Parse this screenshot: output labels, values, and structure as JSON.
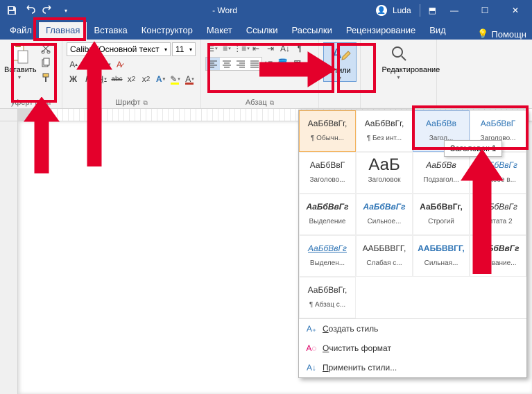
{
  "colors": {
    "brand": "#2b579a",
    "annotation": "#e4002b",
    "accent_blue": "#2e74b5"
  },
  "titlebar": {
    "qat": {
      "save": "save",
      "undo": "undo",
      "redo": "redo",
      "customize": "customize-qat"
    },
    "title": "- Word",
    "user": "Luda",
    "share": "share",
    "win": {
      "min": "minimize",
      "max": "maximize",
      "close": "close"
    }
  },
  "tabs": {
    "items": [
      "Файл",
      "Главная",
      "Вставка",
      "Конструктор",
      "Макет",
      "Ссылки",
      "Рассылки",
      "Рецензирование",
      "Вид"
    ],
    "active_index": 1,
    "help_label": "Помощн"
  },
  "ribbon": {
    "clipboard": {
      "paste_label": "Вставить",
      "group_label": "уферт      на"
    },
    "font": {
      "name": "Calibri (Основной текст",
      "size": "11",
      "group_label": "Шрифт",
      "buttons": {
        "grow": "A▴",
        "shrink": "A▾",
        "change_case": "Aa",
        "clear": "⌫",
        "bold": "Ж",
        "italic": "К",
        "underline": "Ч",
        "strike": "abc",
        "subscript": "x₂",
        "superscript": "x²",
        "text_effects": "A",
        "highlight": "ab",
        "font_color": "A"
      }
    },
    "paragraph": {
      "group_label": "Абзац",
      "buttons": {
        "bullets": "•",
        "numbering": "1",
        "multilevel": "≣",
        "decrease_indent": "⇤",
        "increase_indent": "⇥",
        "sort": "A↓",
        "show_marks": "¶",
        "align_left": "≡",
        "align_center": "≡",
        "align_right": "≡",
        "justify": "≡",
        "line_spacing": "↕",
        "shading": "▭",
        "borders": "▦"
      }
    },
    "styles": {
      "label": "Стили"
    },
    "editing": {
      "label": "Редактирование"
    }
  },
  "styles_panel": {
    "tooltip": "Заголовок 1",
    "cells": [
      {
        "sample": "АаБбВвГг,",
        "label": "¶ Обычн...",
        "cls": "selected"
      },
      {
        "sample": "АаБбВвГг,",
        "label": "¶ Без инт..."
      },
      {
        "sample": "АаБбВв",
        "label": "Загол...",
        "cls": "hover",
        "sample_cls": "blue"
      },
      {
        "sample": "АаБбВвГ",
        "label": "Заголово...",
        "sample_cls": "blue"
      },
      {
        "sample": "АаБбВвГ",
        "label": "Заголово..."
      },
      {
        "sample": "АаБ",
        "label": "Заголовок",
        "sample_cls": "big"
      },
      {
        "sample": "АаБбВв",
        "label": "Подзагол...",
        "sample_cls": "italic"
      },
      {
        "sample": "АаБбВвГг",
        "label": "Слабое в...",
        "sample_cls": "blue italic"
      },
      {
        "sample": "АаБбВвГг",
        "label": "Выделение",
        "sample_cls": "bold italic"
      },
      {
        "sample": "АаБбВвГг",
        "label": "Сильное...",
        "sample_cls": "blue bold italic"
      },
      {
        "sample": "АаБбВвГг,",
        "label": "Строгий",
        "sample_cls": "bold"
      },
      {
        "sample": "АаБбВвГг",
        "label": "Цитата 2",
        "sample_cls": "italic"
      },
      {
        "sample": "АаБбВвГг",
        "label": "Выделен...",
        "sample_cls": "blue italic underline"
      },
      {
        "sample": "ААББВВГГ,",
        "label": "Слабая с..."
      },
      {
        "sample": "ААББВВГГ,",
        "label": "Сильная...",
        "sample_cls": "blue bold"
      },
      {
        "sample": "АаБбВвГг",
        "label": "Название...",
        "sample_cls": "bold italic"
      },
      {
        "sample": "АаБбВвГг,",
        "label": "¶ Абзац с..."
      }
    ],
    "footer": {
      "create": "Создать стиль",
      "create_accel": "С",
      "clear": "Очистить формат",
      "clear_accel": "О",
      "apply": "Применить стили...",
      "apply_accel": "П"
    }
  }
}
